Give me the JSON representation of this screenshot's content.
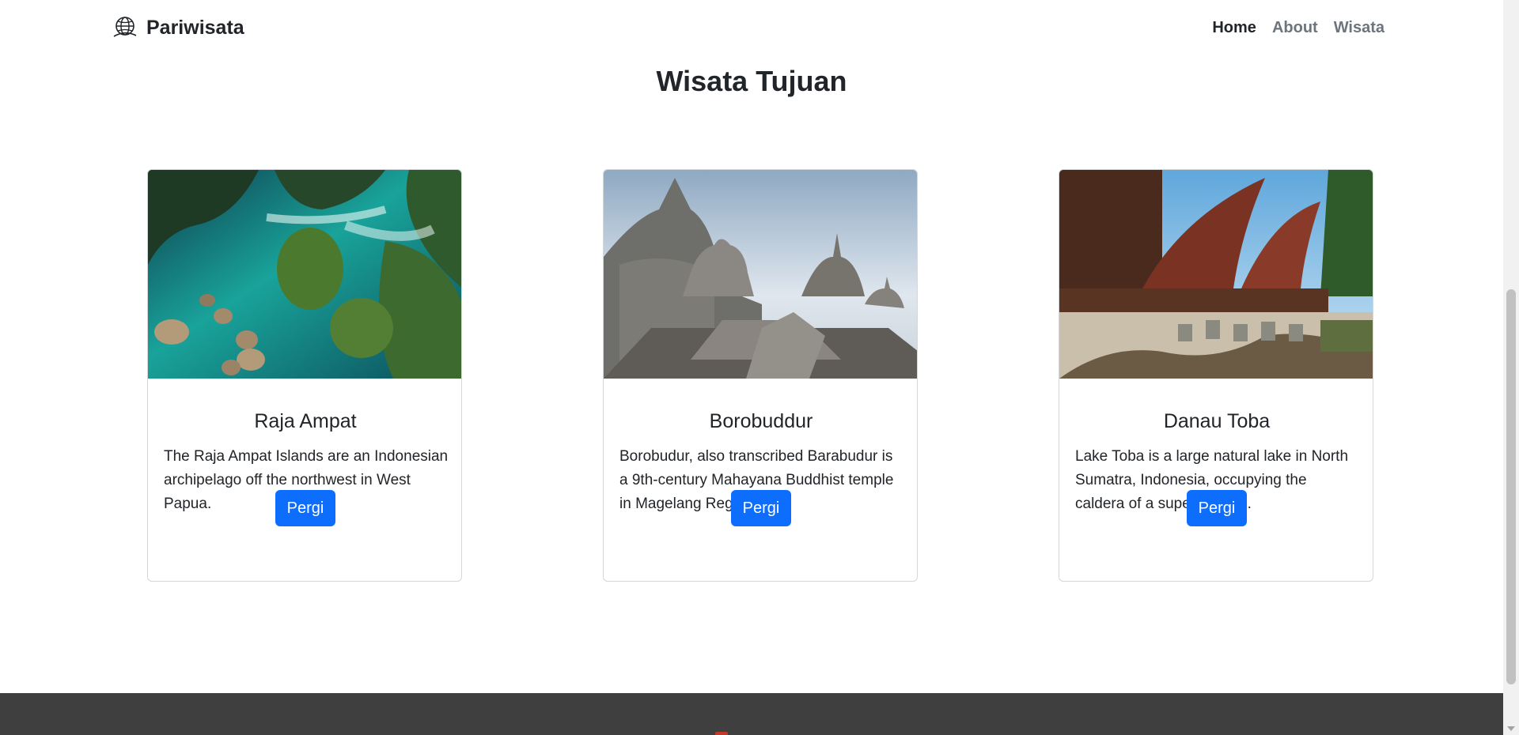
{
  "navbar": {
    "brand": "Pariwisata",
    "brand_icon": "globe-icon",
    "links": [
      {
        "label": "Home",
        "active": true
      },
      {
        "label": "About",
        "active": false
      },
      {
        "label": "Wisata",
        "active": false
      }
    ]
  },
  "section": {
    "title": "Wisata Tujuan"
  },
  "cards": [
    {
      "title": "Raja Ampat",
      "text": "The Raja Ampat Islands are an Indonesian archipelago off the northwest in West Papua.",
      "button": "Pergi",
      "image": "tropical-islands-aerial-photo"
    },
    {
      "title": "Borobuddur",
      "text": "Borobudur, also transcribed Barabudur is a 9th-century Mahayana Buddhist temple in Magelang Regency.",
      "button": "Pergi",
      "image": "borobudur-temple-photo"
    },
    {
      "title": "Danau Toba",
      "text": "Lake Toba is a large natural lake in North Sumatra, Indonesia, occupying the caldera of a supervolcano.",
      "button": "Pergi",
      "image": "batak-traditional-house-photo"
    }
  ],
  "colors": {
    "primary": "#0d6efd",
    "footer": "#3f3f3f",
    "text": "#212529",
    "muted": "#6c757d"
  }
}
